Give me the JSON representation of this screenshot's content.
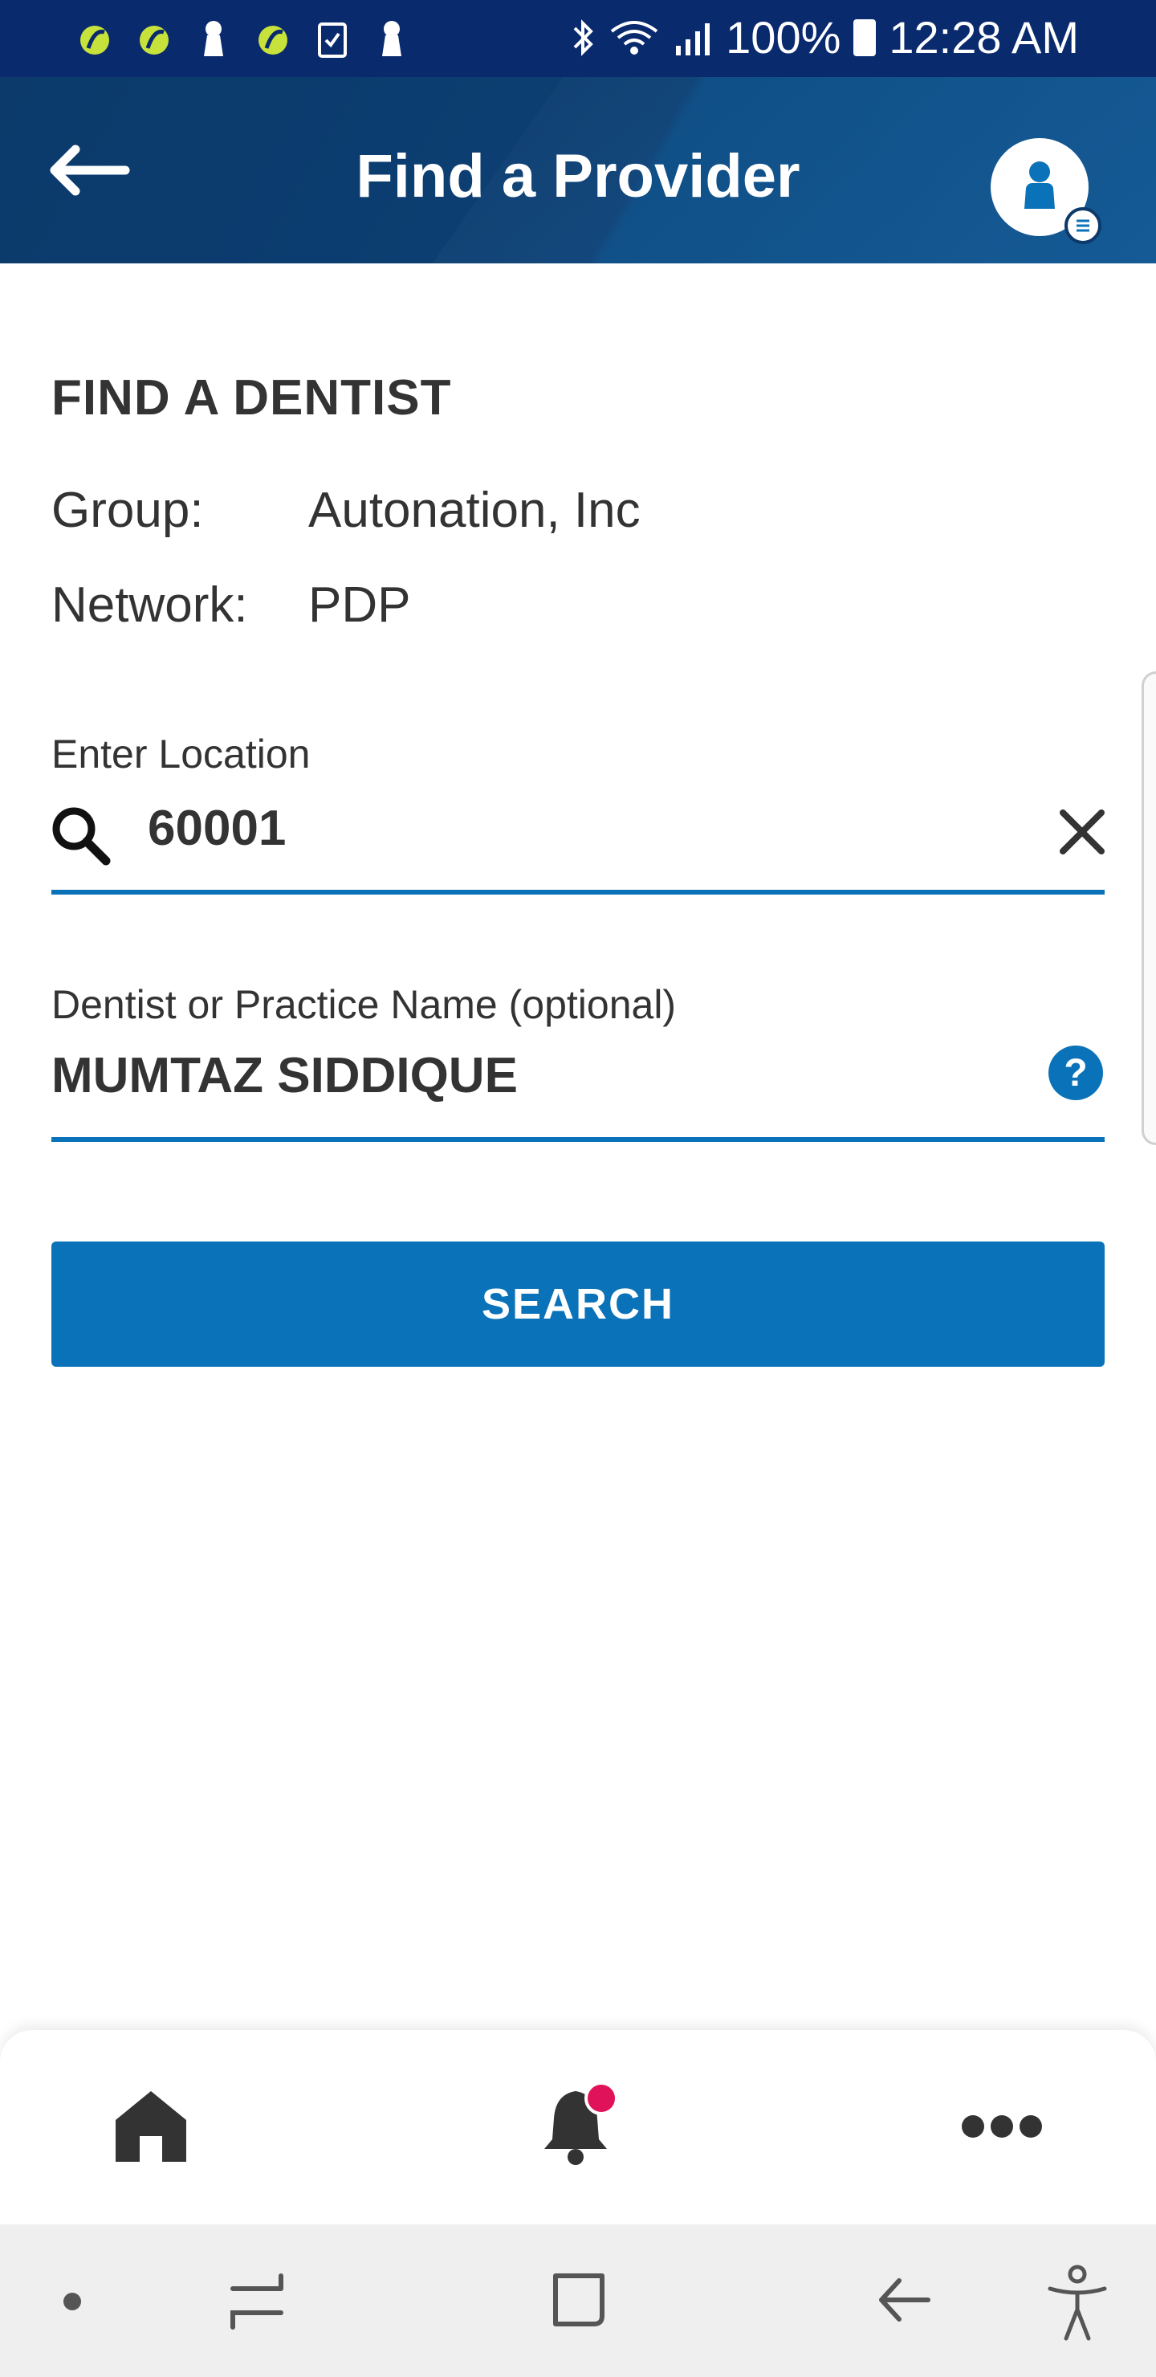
{
  "status_bar": {
    "battery": "100%",
    "time": "12:28 AM",
    "left_icons": [
      "leaf-icon",
      "leaf-icon",
      "keyhole-icon",
      "leaf-icon",
      "clipboard-check-icon",
      "keyhole-icon"
    ],
    "right_icons": [
      "bluetooth-icon",
      "wifi-icon",
      "signal-icon",
      "battery-icon"
    ]
  },
  "header": {
    "title": "Find a Provider",
    "back_icon": "arrow-left-icon",
    "avatar_icon": "person-icon",
    "colors": {
      "background": "#0b3a6b",
      "text": "#ffffff"
    }
  },
  "main": {
    "section_title": "FIND A DENTIST",
    "group_label": "Group:",
    "group_value": "Autonation, Inc",
    "network_label": "Network:",
    "network_value": "PDP",
    "location": {
      "label": "Enter Location",
      "value": "60001",
      "search_icon": "search-icon",
      "clear_icon": "close-icon"
    },
    "dentist": {
      "label": "Dentist or Practice Name (optional)",
      "value": "MUMTAZ SIDDIQUE",
      "help_icon": "question-circle-icon"
    },
    "search_button": "SEARCH",
    "accent_color": "#0a72b8"
  },
  "bottom_nav": {
    "items": [
      {
        "icon": "home-icon"
      },
      {
        "icon": "bell-icon",
        "has_notification": true
      },
      {
        "icon": "more-horizontal-icon"
      }
    ],
    "notification_color": "#e0135a"
  },
  "system_nav": {
    "items": [
      "dot-icon",
      "recent-apps-icon",
      "home-square-icon",
      "back-arrow-icon",
      "accessibility-icon"
    ]
  }
}
